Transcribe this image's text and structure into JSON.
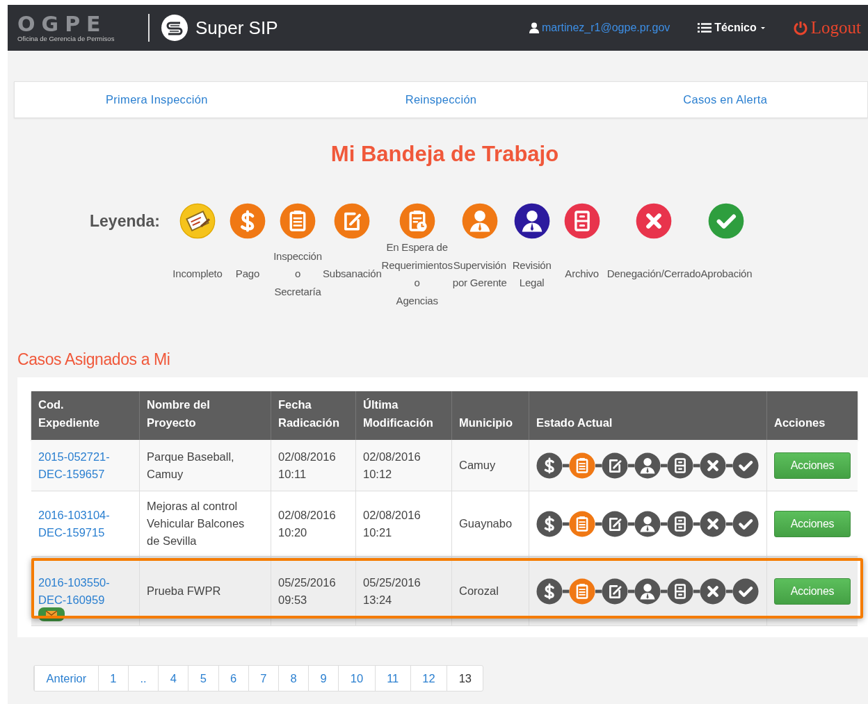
{
  "navbar": {
    "logo": "OGPE",
    "logo_subtitle": "Oficina de Gerencia de Permisos",
    "app_name": "Super SIP",
    "user": "martinez_r1@ogpe.pr.gov",
    "role_menu": "Técnico",
    "logout": "Logout"
  },
  "tabs": [
    {
      "label": "Primera Inspección",
      "selected": false
    },
    {
      "label": "Reinspección",
      "selected": false
    },
    {
      "label": "Casos en Alerta",
      "selected": false
    }
  ],
  "page_title": "Mi Bandeja de Trabajo",
  "legend": {
    "label": "Leyenda:",
    "items": [
      {
        "kind": "incompleto",
        "label": "Incompleto",
        "color": "#f5c31c"
      },
      {
        "kind": "pago",
        "label": "Pago",
        "color": "#f07814"
      },
      {
        "kind": "inspeccion",
        "label": "Inspección\no\nSecretaría",
        "color": "#f07814"
      },
      {
        "kind": "subsanacion",
        "label": "Subsanación",
        "color": "#f07814"
      },
      {
        "kind": "espera",
        "label": "En Espera de\nRequerimientos\no\nAgencias",
        "color": "#f07814"
      },
      {
        "kind": "supervision",
        "label": "Supervisión\npor Gerente",
        "color": "#f07814"
      },
      {
        "kind": "revision",
        "label": "Revisión\nLegal",
        "color": "#2c1a9e"
      },
      {
        "kind": "archivo",
        "label": "Archivo",
        "color": "#e8344c"
      },
      {
        "kind": "denegacion",
        "label": "Denegación/Cerrado",
        "color": "#e8344c"
      },
      {
        "kind": "aprobacion",
        "label": "Aprobación",
        "color": "#2e9e3e"
      }
    ]
  },
  "section_title": "Casos Asignados a Mi",
  "table": {
    "columns": [
      "Cod.\nExpediente",
      "Nombre del\nProyecto",
      "Fecha\nRadicación",
      "Última\nModificación",
      "Municipio",
      "Estado Actual",
      "Acciones"
    ],
    "rows": [
      {
        "cod": "2015-052721-DEC-159657",
        "project": "Parque Baseball,\nCamuy",
        "filed": "02/08/2016\n10:11",
        "modified": "02/08/2016\n10:12",
        "municipality": "Camuy",
        "highlighted": false,
        "message_badge": false,
        "action": "Acciones",
        "status": [
          {
            "kind": "pago",
            "active": false
          },
          {
            "kind": "inspeccion",
            "active": true
          },
          {
            "kind": "subsanacion",
            "active": false
          },
          {
            "kind": "supervision",
            "active": false
          },
          {
            "kind": "archivo",
            "active": false
          },
          {
            "kind": "denegacion",
            "active": false
          },
          {
            "kind": "aprobacion",
            "active": false
          }
        ]
      },
      {
        "cod": "2016-103104-DEC-159715",
        "project": "Mejoras al control\nVehicular Balcones\nde Sevilla",
        "filed": "02/08/2016\n10:20",
        "modified": "02/08/2016\n10:21",
        "municipality": "Guaynabo",
        "highlighted": false,
        "message_badge": false,
        "action": "Acciones",
        "status": [
          {
            "kind": "pago",
            "active": false
          },
          {
            "kind": "inspeccion",
            "active": true
          },
          {
            "kind": "subsanacion",
            "active": false
          },
          {
            "kind": "supervision",
            "active": false
          },
          {
            "kind": "archivo",
            "active": false
          },
          {
            "kind": "denegacion",
            "active": false
          },
          {
            "kind": "aprobacion",
            "active": false
          }
        ]
      },
      {
        "cod": "2016-103550-DEC-160959",
        "project": "Prueba FWPR",
        "filed": "05/25/2016\n09:53",
        "modified": "05/25/2016\n13:24",
        "municipality": "Corozal",
        "highlighted": true,
        "message_badge": true,
        "action": "Acciones",
        "status": [
          {
            "kind": "pago",
            "active": false
          },
          {
            "kind": "inspeccion",
            "active": true
          },
          {
            "kind": "subsanacion",
            "active": false
          },
          {
            "kind": "supervision",
            "active": false
          },
          {
            "kind": "archivo",
            "active": false
          },
          {
            "kind": "denegacion",
            "active": false
          },
          {
            "kind": "aprobacion",
            "active": false
          }
        ]
      }
    ]
  },
  "pagination": [
    {
      "label": "Anterior",
      "selected": false
    },
    {
      "label": "1",
      "selected": false
    },
    {
      "label": "..",
      "selected": false
    },
    {
      "label": "4",
      "selected": false
    },
    {
      "label": "5",
      "selected": false
    },
    {
      "label": "6",
      "selected": false
    },
    {
      "label": "7",
      "selected": false
    },
    {
      "label": "8",
      "selected": false
    },
    {
      "label": "9",
      "selected": false
    },
    {
      "label": "10",
      "selected": false
    },
    {
      "label": "11",
      "selected": false
    },
    {
      "label": "12",
      "selected": false
    },
    {
      "label": "13",
      "selected": true
    }
  ]
}
